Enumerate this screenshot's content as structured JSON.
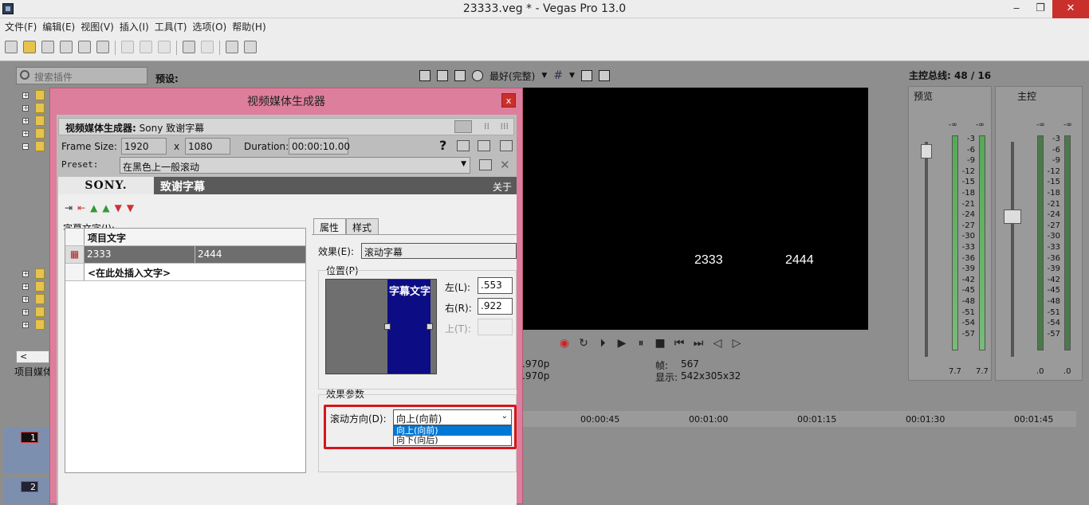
{
  "window": {
    "title": "23333.veg * - Vegas Pro 13.0",
    "min": "‒",
    "max": "❐",
    "close": "✕"
  },
  "menu": [
    "文件(F)",
    "编辑(E)",
    "视图(V)",
    "插入(I)",
    "工具(T)",
    "选项(O)",
    "帮助(H)"
  ],
  "left": {
    "search_placeholder": "搜索插件",
    "preset_label": "预设:",
    "project_tab": "项目媒体",
    "scroll_left": "<"
  },
  "preview": {
    "quality": "最好(完整)",
    "text1": "2333",
    "text2": "2444",
    "info_l1": ".970p",
    "info_l2": ".970p",
    "frame_label": "帧:",
    "frame_value": "567",
    "display_label": "显示:",
    "display_value": "542x305x32"
  },
  "mixer": {
    "title": "主控总线: 48 / 16",
    "preview_label": "预览",
    "master_label": "主控",
    "neg_inf": "-∞",
    "scale": [
      "3",
      "6",
      "9",
      "12",
      "15",
      "18",
      "21",
      "24",
      "27",
      "30",
      "33",
      "36",
      "39",
      "42",
      "45",
      "48",
      "51",
      "54",
      "57"
    ],
    "level_l": "7.7",
    "level_r": "7.7",
    "master_l": ".0",
    "master_r": ".0"
  },
  "timeline": {
    "marks": [
      "00:00:45",
      "00:01:00",
      "00:01:15",
      "00:01:30",
      "00:01:45"
    ],
    "track1": "1",
    "track2": "2"
  },
  "dialog": {
    "title": "视频媒体生成器",
    "close": "x",
    "generator_label": "视频媒体生成器:",
    "generator_name": "Sony 致谢字幕",
    "frame_size_label": "Frame Size:",
    "width": "1920",
    "x": "x",
    "height": "1080",
    "duration_label": "Duration:",
    "duration": "00:00:10.00",
    "help": "?",
    "preset_label": "Preset:",
    "preset_value": "在黑色上一般滚动",
    "sony": "SONY.",
    "plugin_title": "致谢字幕",
    "about": "关于",
    "subtitle_text_label": "字幕文字(I):",
    "grid_header": "项目文字",
    "row1_col1": "2333",
    "row1_col2": "2444",
    "insert_hint": "<在此处插入文字>",
    "tab_props": "属性",
    "tab_style": "样式",
    "effect_label": "效果(E):",
    "effect_value": "滚动字幕",
    "position_label": "位置(P)",
    "pos_preview_text": "字幕文字",
    "left_label": "左(L):",
    "left_value": ".553",
    "right_label": "右(R):",
    "right_value": ".922",
    "top_label": "上(T):",
    "effect_params_label": "效果参数",
    "scroll_dir_label": "滚动方向(D):",
    "scroll_dir_value": "向上(向前)",
    "options": [
      "向上(向前)",
      "向下(向后)"
    ]
  },
  "colors": {
    "dialog_frame": "#dd7f9c",
    "selection_blue": "#0078d7",
    "highlight_red": "#d4171c",
    "title_blue": "#0c0c84"
  }
}
